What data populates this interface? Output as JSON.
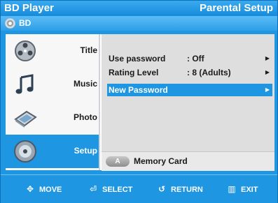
{
  "header": {
    "app_title": "BD Player",
    "page_title": "Parental Setup"
  },
  "source": {
    "label": "BD",
    "icon": "disc-icon"
  },
  "menu": [
    {
      "label": "Title",
      "icon": "film-reel-icon",
      "selected": false
    },
    {
      "label": "Music",
      "icon": "music-note-icon",
      "selected": false
    },
    {
      "label": "Photo",
      "icon": "photo-icon",
      "selected": false
    },
    {
      "label": "Setup",
      "icon": "setup-disc-icon",
      "selected": true
    }
  ],
  "settings": [
    {
      "label": "Use password",
      "value": ": Off",
      "arrow": "▶",
      "selected": false
    },
    {
      "label": "Rating Level",
      "value": ": 8 (Adults)",
      "arrow": "▶",
      "selected": false
    },
    {
      "label": "New Password",
      "value": "",
      "arrow": "▶",
      "selected": true
    }
  ],
  "memory_card": {
    "button": "A",
    "label": "Memory Card"
  },
  "footer": [
    {
      "glyph": "✥",
      "label": "MOVE",
      "icon": "move-icon"
    },
    {
      "glyph": "⏎",
      "label": "SELECT",
      "icon": "select-icon"
    },
    {
      "glyph": "↺",
      "label": "RETURN",
      "icon": "return-icon"
    },
    {
      "glyph": "▥",
      "label": "EXIT",
      "icon": "exit-icon"
    }
  ],
  "colors": {
    "accent": "#1e96e2",
    "panel": "#dedede",
    "menu_bg": "#f7f7f7"
  }
}
